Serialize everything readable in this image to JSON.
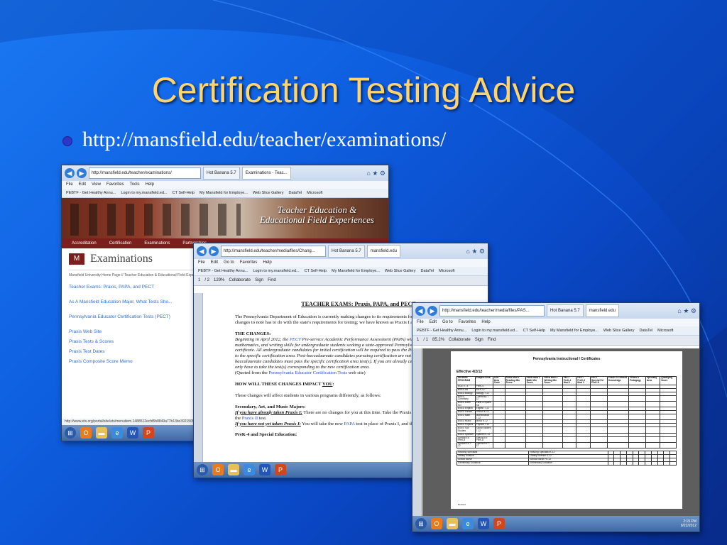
{
  "slide": {
    "title": "Certification Testing Advice",
    "bullet": "http://mansfield.edu/teacher/examinations/",
    "colors": {
      "title": "#ffd46e",
      "background": "#0e5fe0",
      "bullet_dot": "#2e36c9"
    }
  },
  "win1": {
    "address": "http://mansfield.edu/teacher/examinations/",
    "tabs": [
      "Hot Banana 5.7",
      "Examinations - Teac..."
    ],
    "menu": [
      "File",
      "Edit",
      "View",
      "Favorites",
      "Tools",
      "Help"
    ],
    "favorites": [
      "PEBTF - Get Healthy Annu...",
      "Login to my.mansfield.ed...",
      "CT Self-Help",
      "My Mansfield for Employe...",
      "Web Slice Gallery",
      "DataTel",
      "Microsoft"
    ],
    "banner_text_line1": "Teacher Education &",
    "banner_text_line2": "Educational Field Experiences",
    "nav": [
      "Accreditation",
      "Certification",
      "Examinations",
      "Partnerships"
    ],
    "heading": "Examinations",
    "breadcrumb": "Mansfield University Home Page // Teacher Education & Educational Field Expe...",
    "links_spaced": [
      "Teacher Exams: Praxis, PAPA, and PECT",
      "As A Mansfield Education Major, What Tests Sho...",
      "Pennsylvania Educator Certification Tests (PECT)"
    ],
    "links_tight": [
      "Praxis Web Site",
      "Praxis Tests & Scores",
      "Praxis Test Dates",
      "Praxis Composite Score Memo"
    ],
    "status": "http://www.ets.org/portal/site/ets/menuitem.1488512ecfd5b8849a77b13bc3921509/?vgnextoid=..."
  },
  "win2": {
    "address": "http://mansfield.edu/teacher/media/files/Chang...",
    "tabs": [
      "Hot Banana 5.7",
      "mansfield.edu"
    ],
    "menu": [
      "File",
      "Edit",
      "Go to",
      "Favorites",
      "Help"
    ],
    "favorites": [
      "PEBTF - Get Healthy Annu...",
      "Login to my.mansfield.ed...",
      "CT Self-Help",
      "My Mansfield for Employe...",
      "Web Slice Gallery",
      "DataTel",
      "Microsoft"
    ],
    "pdf_toolbar": [
      "1",
      "/ 2",
      "129%",
      "Collaborate",
      "Sign",
      "Find"
    ],
    "doc": {
      "title": "TEACHER EXAMS: Praxis, PAPA, and PECT",
      "intro": "The Pennsylvania Department of Education is currently making changes to its requirements for certifying teachers. One of these changes to note has to do with the state's requirements for testing; we have known as Praxis I and Praxis II.",
      "changes_head": "THE CHANGES:",
      "changes_pre": "Beginning in April 2012, the ",
      "changes_pect": "PECT",
      "changes_body": " Pre-service Academic Performance Assessment (PAPA) will be the means of assessing reading, mathematics, and writing skills for undergraduate students seeking a state-approved Pennsylvania educator preparation certificate. All undergraduate candidates for initial certification will be required to pass the PAPA as well as the test corresponding to the specific certification area. Post-baccalaureate candidates pursuing certification are not required to take the PAPA. Post-baccalaureate candidates must pass the specific certification area test(s). If you are already certified and adding another area, you only have to take the test(s) corresponding to the new certification area.",
      "quoted_pre": "(Quoted from the ",
      "quoted_link": "Pennsylvania Educator Certification Tests",
      "quoted_post": " web site)",
      "impact_pre": "HOW WILL THESE CHANGES IMPACT ",
      "impact_you": "YOU",
      "impact_post": ":",
      "affect": "These changes will affect students in various programs differently, as follows:",
      "sec_head": "Secondary, Art, and Music Majors:",
      "sec_a_label": "If you have already taken Praxis I:",
      "sec_a_text": " There are no changes for you at this time. Take the Praxis II test you anticipated, you will take the ",
      "sec_a_link": "Praxis II",
      "sec_a_end": " test.",
      "sec_b_label": "If you have not yet taken Praxis I:",
      "sec_b_text": " You will take the new ",
      "sec_b_link": "PAPA",
      "sec_b_end": " test in place of Praxis I, and then you will take Praxis II.",
      "prek_head": "PreK-4 and Special Education:"
    }
  },
  "win3": {
    "address": "http://mansfield.edu/teacher/media/files/PAS...",
    "tabs": [
      "Hot Banana 5.7",
      "mansfield.edu"
    ],
    "menu": [
      "File",
      "Edit",
      "Go to",
      "Favorites",
      "Help"
    ],
    "favorites": [
      "PEBTF - Get Healthy Annu...",
      "Login to my.mansfield.ed...",
      "CT Self-Help",
      "My Mansfield for Employe...",
      "Web Slice Gallery",
      "DataTel",
      "Microsoft"
    ],
    "pdf_toolbar": [
      "1",
      "/ 1",
      "85.2%",
      "Collaborate",
      "Sign",
      "Find"
    ],
    "doc_title": "Pennsylvania Instructional I Certificates",
    "effective": "Effective 4/2/12",
    "table_headers": [
      "DEGREE PROGRAM",
      "Subject Area",
      "Cert Area Code",
      "PAPA Mod 1 Reading Min Score",
      "PAPA Mod 2 Math Min Score",
      "PAPA Mod 3 Writing Min Score",
      "PECT PreK-4 Mod 1",
      "PECT PreK-4 Mod 2",
      "PECT Special Ed PreK-8",
      "Praxis II Content Knowledge",
      "Praxis II Pedagogy",
      "Specialty Area",
      "Qualifying Score"
    ],
    "table_rows": [
      [
        "ECE 0 - 4",
        "PreK-4",
        "",
        "",
        "",
        "",
        "",
        "",
        "",
        "",
        "",
        "",
        ""
      ],
      [
        "BSED Art",
        "Art K-12",
        "",
        "",
        "",
        "",
        "",
        "",
        "",
        "",
        "",
        "",
        ""
      ],
      [
        "BSED Biology",
        "Biology 7-12",
        "",
        "",
        "",
        "",
        "",
        "",
        "",
        "",
        "",
        "",
        ""
      ],
      [
        "BSED Chemistry",
        "Chemistry 7-12",
        "",
        "",
        "",
        "",
        "",
        "",
        "",
        "",
        "",
        "",
        ""
      ],
      [
        "BSED Earth Sci",
        "Earth & Space Sci",
        "",
        "",
        "",
        "",
        "",
        "",
        "",
        "",
        "",
        "",
        ""
      ],
      [
        "BSED English",
        "English 7-12",
        "",
        "",
        "",
        "",
        "",
        "",
        "",
        "",
        "",
        "",
        ""
      ],
      [
        "BSED French",
        "French K-12",
        "",
        "",
        "",
        "",
        "",
        "",
        "",
        "",
        "",
        "",
        ""
      ],
      [
        "BSED Math",
        "Mathematics 7-12",
        "",
        "",
        "",
        "",
        "",
        "",
        "",
        "",
        "",
        "",
        ""
      ],
      [
        "BSED Music",
        "Music K-12",
        "",
        "",
        "",
        "",
        "",
        "",
        "",
        "",
        "",
        "",
        ""
      ],
      [
        "BSED Physics",
        "Physics 7-12",
        "",
        "",
        "",
        "",
        "",
        "",
        "",
        "",
        "",
        "",
        ""
      ],
      [
        "BSED Soc Studies",
        "Social Studies 7-12",
        "",
        "",
        "",
        "",
        "",
        "",
        "",
        "",
        "",
        "",
        ""
      ],
      [
        "BSED Spanish",
        "Spanish K-12",
        "",
        "",
        "",
        "",
        "",
        "",
        "",
        "",
        "",
        "",
        ""
      ],
      [
        "Special Ed PreK-8",
        "Special Ed PreK-8",
        "",
        "",
        "",
        "",
        "",
        "",
        "",
        "",
        "",
        "",
        ""
      ],
      [
        "Special Ed 7-12",
        "Special Ed 7-12",
        "",
        "",
        "",
        "",
        "",
        "",
        "",
        "",
        "",
        "",
        ""
      ]
    ],
    "table_rows_2": [
      [
        "Reading Specialist",
        "Reading Specialist K-12",
        "",
        "",
        "",
        "",
        "",
        "",
        "",
        "",
        "",
        "",
        ""
      ],
      [
        "Library Science",
        "Library Science K-12",
        "",
        "",
        "",
        "",
        "",
        "",
        "",
        "",
        "",
        "",
        ""
      ],
      [
        "School Nurse",
        "School Nurse PK-12",
        "",
        "",
        "",
        "",
        "",
        "",
        "",
        "",
        "",
        "",
        ""
      ],
      [
        "Elementary Guidance",
        "Elementary Guidance",
        "",
        "",
        "",
        "",
        "",
        "",
        "",
        "",
        "",
        "",
        ""
      ]
    ],
    "footer": "Revised",
    "clock_time": "2:15 PM",
    "clock_date": "9/22/2012"
  },
  "taskbar_icons": [
    "start-orb",
    "outlook",
    "explorer",
    "ie",
    "word",
    "powerpoint"
  ]
}
